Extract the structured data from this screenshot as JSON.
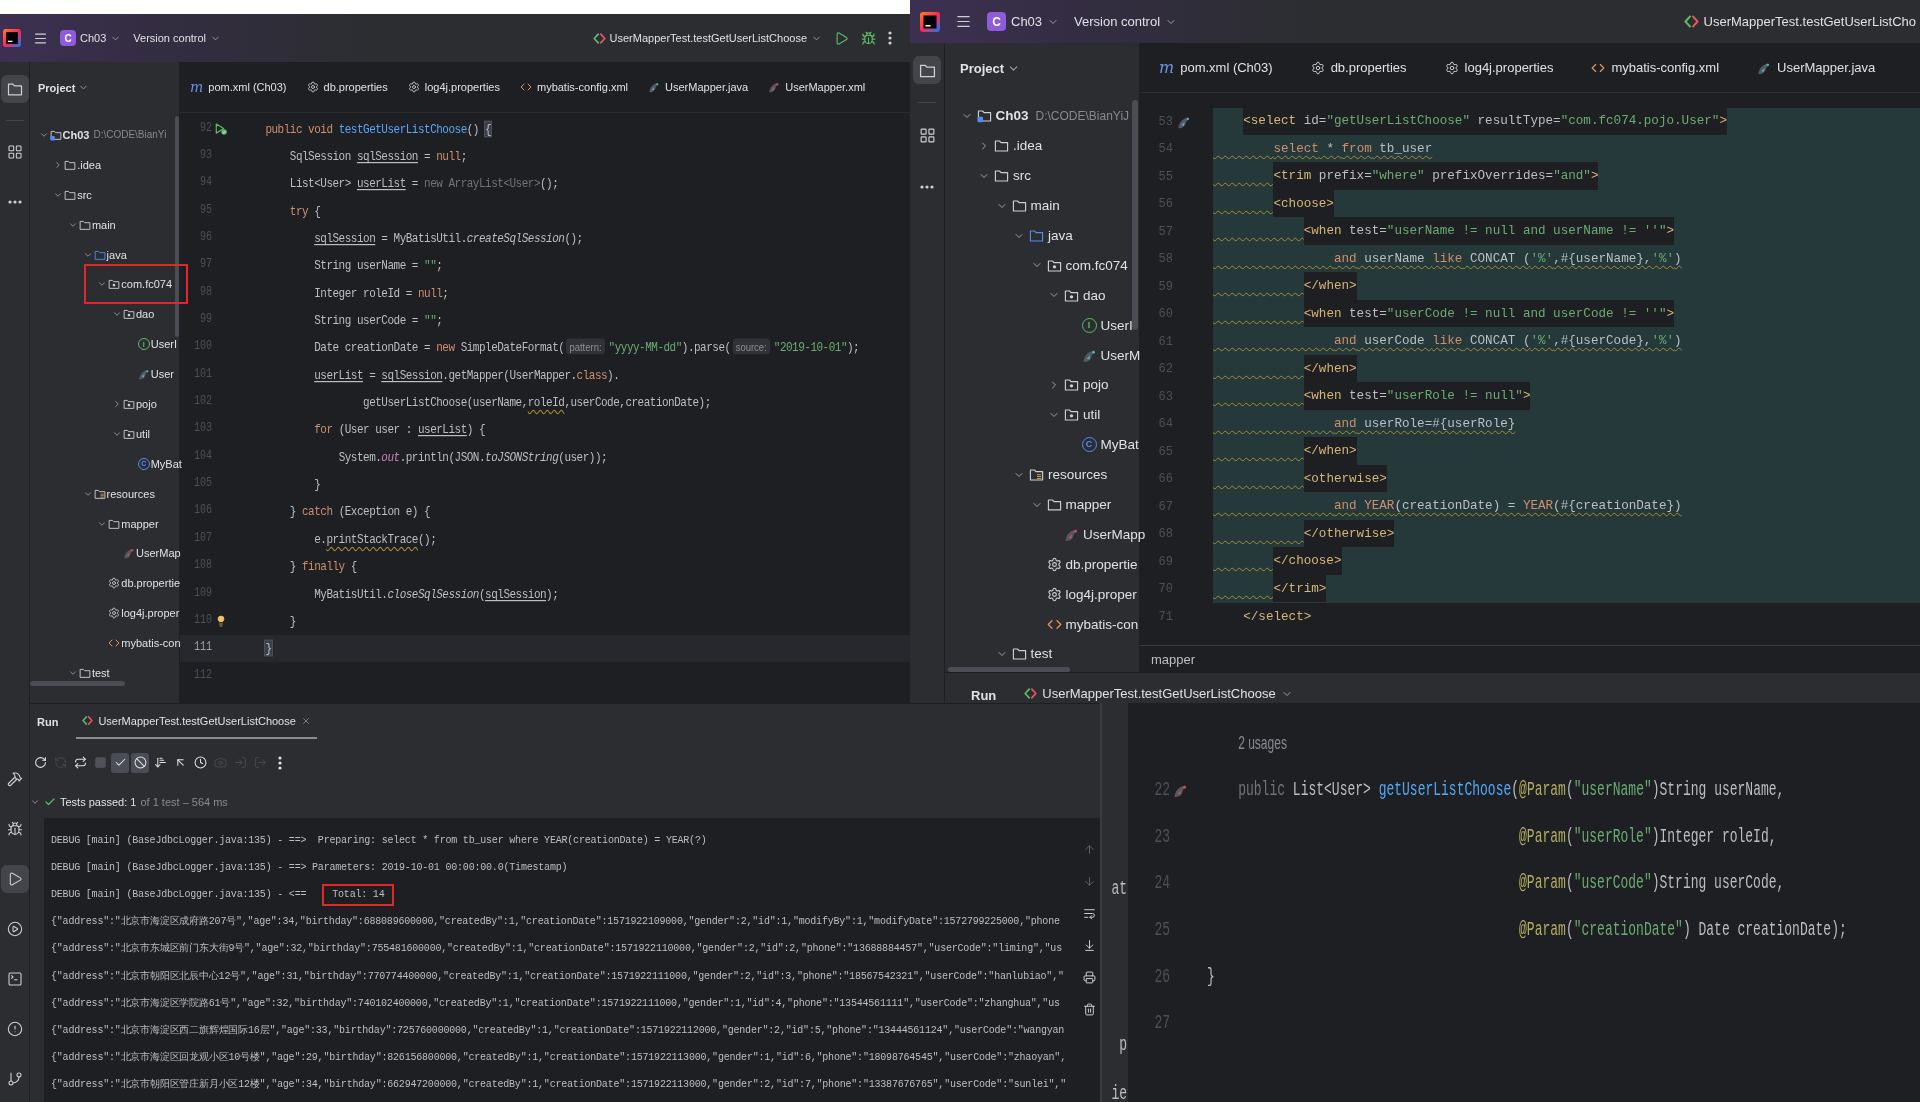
{
  "left_window": {
    "title_bar": {
      "project_initial": "C",
      "project": "Ch03",
      "vcs": "Version control",
      "run_config": "UserMapperTest.testGetUserListChoose"
    },
    "tool_strip": {
      "top": [
        {
          "kind": "project",
          "selected": true
        },
        {
          "kind": "structure",
          "selected": false
        },
        {
          "kind": "more",
          "selected": false
        }
      ],
      "bottom": [
        {
          "kind": "build",
          "selected": false
        },
        {
          "kind": "debug",
          "selected": false
        },
        {
          "kind": "run",
          "selected": true
        },
        {
          "kind": "services",
          "selected": false
        },
        {
          "kind": "terminal",
          "selected": false
        },
        {
          "kind": "problems",
          "selected": false
        },
        {
          "kind": "vcs",
          "selected": false
        }
      ]
    },
    "project_panel": {
      "title": "Project",
      "tree": [
        {
          "label": "Ch03",
          "path": "D:\\CODE\\BianYi",
          "kind": "module",
          "expanded": true,
          "marked": false,
          "children": [
            {
              "label": ".idea",
              "kind": "folder",
              "expanded": false,
              "marked": false
            },
            {
              "label": "src",
              "kind": "folder",
              "expanded": true,
              "marked": false,
              "children": [
                {
                  "label": "main",
                  "kind": "folder",
                  "expanded": true,
                  "marked": false,
                  "children": [
                    {
                      "label": "java",
                      "kind": "source",
                      "expanded": true,
                      "marked": false,
                      "children": [
                        {
                          "label": "com.fc074",
                          "kind": "package",
                          "expanded": true,
                          "marked": true,
                          "children": [
                            {
                              "label": "dao",
                              "kind": "package",
                              "expanded": true,
                              "marked": false,
                              "children": [
                                {
                                  "label": "UserI",
                                  "kind": "interface",
                                  "glyph": "I",
                                  "marked": false
                                },
                                {
                                  "label": "User",
                                  "kind": "mapper-java",
                                  "marked": false
                                }
                              ]
                            },
                            {
                              "label": "pojo",
                              "kind": "package",
                              "expanded": false,
                              "marked": false
                            },
                            {
                              "label": "util",
                              "kind": "package",
                              "expanded": true,
                              "marked": false,
                              "children": [
                                {
                                  "label": "MyBat",
                                  "kind": "class",
                                  "glyph": "C",
                                  "marked": false
                                }
                              ]
                            }
                          ]
                        }
                      ]
                    },
                    {
                      "label": "resources",
                      "kind": "resources",
                      "expanded": true,
                      "marked": false,
                      "children": [
                        {
                          "label": "mapper",
                          "kind": "folder",
                          "expanded": true,
                          "marked": false,
                          "children": [
                            {
                              "label": "UserMap",
                              "kind": "mapper-xml",
                              "marked": false
                            }
                          ]
                        },
                        {
                          "label": "db.propertie",
                          "kind": "properties",
                          "marked": false
                        },
                        {
                          "label": "log4j.proper",
                          "kind": "properties",
                          "marked": false
                        },
                        {
                          "label": "mybatis-con",
                          "kind": "xml",
                          "marked": false
                        }
                      ]
                    }
                  ]
                },
                {
                  "label": "test",
                  "kind": "folder",
                  "expanded": true,
                  "marked": false
                }
              ]
            }
          ]
        }
      ]
    },
    "tabs": [
      {
        "kind": "maven",
        "glyph": "m",
        "label": "pom.xml (Ch03)"
      },
      {
        "kind": "properties",
        "label": "db.properties"
      },
      {
        "kind": "properties",
        "label": "log4j.properties"
      },
      {
        "kind": "xml",
        "label": "mybatis-config.xml"
      },
      {
        "kind": "mapper-java",
        "label": "UserMapper.java"
      },
      {
        "kind": "mapper-xml",
        "label": "UserMapper.xml"
      }
    ],
    "editor": {
      "lines": [
        {
          "number": "92",
          "marker": {
            "kind": "run"
          },
          "current": false,
          "segments": [
            {
              "kind": "keyword",
              "text": "    public void "
            },
            {
              "kind": "method",
              "text": "testGetUserListChoose"
            },
            {
              "kind": "plain",
              "text": "() "
            },
            {
              "kind": "brace",
              "text": "{"
            }
          ]
        },
        {
          "number": "93",
          "current": false,
          "segments": [
            {
              "kind": "plain",
              "text": "        SqlSession "
            },
            {
              "kind": "reassigned",
              "text": "sqlSession"
            },
            {
              "kind": "plain",
              "text": " = "
            },
            {
              "kind": "keyword",
              "text": "null"
            },
            {
              "kind": "plain",
              "text": ";"
            }
          ]
        },
        {
          "number": "94",
          "current": false,
          "segments": [
            {
              "kind": "plain",
              "text": "        List<User> "
            },
            {
              "kind": "reassigned",
              "text": "userList"
            },
            {
              "kind": "plain",
              "text": " = "
            },
            {
              "kind": "dim",
              "text": "new ArrayList<User>"
            },
            {
              "kind": "plain",
              "text": "();"
            }
          ]
        },
        {
          "number": "95",
          "current": false,
          "segments": [
            {
              "kind": "keyword",
              "text": "        try "
            },
            {
              "kind": "plain",
              "text": "{"
            }
          ]
        },
        {
          "number": "96",
          "current": false,
          "segments": [
            {
              "kind": "reassigned",
              "text": "            sqlSession"
            },
            {
              "kind": "plain",
              "text": " = MyBatisUtil."
            },
            {
              "kind": "static",
              "text": "createSqlSession"
            },
            {
              "kind": "plain",
              "text": "();"
            }
          ]
        },
        {
          "number": "97",
          "current": false,
          "segments": [
            {
              "kind": "plain",
              "text": "            String userName = "
            },
            {
              "kind": "string",
              "text": "\"\""
            },
            {
              "kind": "plain",
              "text": ";"
            }
          ]
        },
        {
          "number": "98",
          "current": false,
          "segments": [
            {
              "kind": "plain",
              "text": "            Integer roleId = "
            },
            {
              "kind": "keyword",
              "text": "null"
            },
            {
              "kind": "plain",
              "text": ";"
            }
          ]
        },
        {
          "number": "99",
          "current": false,
          "segments": [
            {
              "kind": "plain",
              "text": "            String userCode = "
            },
            {
              "kind": "string",
              "text": "\"\""
            },
            {
              "kind": "plain",
              "text": ";"
            }
          ]
        },
        {
          "number": "100",
          "current": false,
          "segments": [
            {
              "kind": "plain",
              "text": "            Date creationDate = "
            },
            {
              "kind": "keyword",
              "text": "new "
            },
            {
              "kind": "plain",
              "text": "SimpleDateFormat("
            },
            {
              "kind": "hint",
              "text": "pattern:"
            },
            {
              "kind": "string",
              "text": "\"yyyy-MM-dd\""
            },
            {
              "kind": "plain",
              "text": ").parse("
            },
            {
              "kind": "hint",
              "text": "source:"
            },
            {
              "kind": "string",
              "text": "\"2019-10-01\""
            },
            {
              "kind": "plain",
              "text": ");"
            }
          ]
        },
        {
          "number": "101",
          "current": false,
          "segments": [
            {
              "kind": "reassigned",
              "text": "            userList"
            },
            {
              "kind": "plain",
              "text": " = "
            },
            {
              "kind": "reassigned",
              "text": "sqlSession"
            },
            {
              "kind": "plain",
              "text": ".getMapper(UserMapper."
            },
            {
              "kind": "keyword",
              "text": "class"
            },
            {
              "kind": "plain",
              "text": ")."
            }
          ]
        },
        {
          "number": "102",
          "current": false,
          "segments": [
            {
              "kind": "plain",
              "text": "                    getUserListChoose(userName,"
            },
            {
              "kind": "warning",
              "text": "roleId"
            },
            {
              "kind": "plain",
              "text": ",userCode,creationDate);"
            }
          ]
        },
        {
          "number": "103",
          "current": false,
          "segments": [
            {
              "kind": "keyword",
              "text": "            for "
            },
            {
              "kind": "plain",
              "text": "(User user : "
            },
            {
              "kind": "reassigned",
              "text": "userList"
            },
            {
              "kind": "plain",
              "text": ") {"
            }
          ]
        },
        {
          "number": "104",
          "current": false,
          "segments": [
            {
              "kind": "plain",
              "text": "                System."
            },
            {
              "kind": "field",
              "text": "out"
            },
            {
              "kind": "plain",
              "text": ".println(JSON."
            },
            {
              "kind": "static",
              "text": "toJSONString"
            },
            {
              "kind": "plain",
              "text": "(user));"
            }
          ]
        },
        {
          "number": "105",
          "current": false,
          "segments": [
            {
              "kind": "plain",
              "text": "            }"
            }
          ]
        },
        {
          "number": "106",
          "current": false,
          "segments": [
            {
              "kind": "plain",
              "text": "        } "
            },
            {
              "kind": "keyword",
              "text": "catch "
            },
            {
              "kind": "plain",
              "text": "(Exception e) {"
            }
          ]
        },
        {
          "number": "107",
          "current": false,
          "segments": [
            {
              "kind": "plain",
              "text": "            e."
            },
            {
              "kind": "warning",
              "text": "printStackTrace"
            },
            {
              "kind": "plain",
              "text": "();"
            }
          ]
        },
        {
          "number": "108",
          "current": false,
          "segments": [
            {
              "kind": "plain",
              "text": "        } "
            },
            {
              "kind": "keyword",
              "text": "finally "
            },
            {
              "kind": "plain",
              "text": "{"
            }
          ]
        },
        {
          "number": "109",
          "current": false,
          "segments": [
            {
              "kind": "plain",
              "text": "            MyBatisUtil."
            },
            {
              "kind": "static",
              "text": "closeSqlSession"
            },
            {
              "kind": "plain",
              "text": "("
            },
            {
              "kind": "reassigned",
              "text": "sqlSession"
            },
            {
              "kind": "plain",
              "text": ");"
            }
          ]
        },
        {
          "number": "110",
          "marker": {
            "kind": "intention"
          },
          "current": false,
          "segments": [
            {
              "kind": "plain",
              "text": "        }"
            }
          ]
        },
        {
          "number": "111",
          "current": true,
          "segments": [
            {
              "kind": "brace",
              "text": "    }"
            }
          ]
        },
        {
          "number": "112",
          "current": false
        }
      ]
    },
    "run_panel": {
      "title": "Run",
      "tab": "UserMapperTest.testGetUserListChoose",
      "toolbar": [
        {
          "kind": "rerun",
          "on": false,
          "disabled": false
        },
        {
          "kind": "rerun-failed",
          "on": false,
          "disabled": true
        },
        {
          "kind": "rerun-auto",
          "on": false,
          "disabled": false
        },
        {
          "kind": "stop",
          "on": false,
          "disabled": true
        },
        {
          "kind": "show-passed",
          "on": true,
          "disabled": false
        },
        {
          "kind": "show-ignored",
          "on": true,
          "disabled": false
        },
        {
          "kind": "sort",
          "on": false,
          "disabled": false
        },
        {
          "kind": "collapse",
          "on": false,
          "disabled": false
        },
        {
          "kind": "history",
          "on": false,
          "disabled": false
        },
        {
          "kind": "screenshot",
          "on": false,
          "disabled": true
        },
        {
          "kind": "import",
          "on": false,
          "disabled": true
        },
        {
          "kind": "export",
          "on": false,
          "disabled": true
        },
        {
          "kind": "more",
          "on": false,
          "disabled": false
        }
      ],
      "summary": {
        "expanded": true,
        "status": "Tests passed: 1",
        "detail": "of 1 test – 564 ms"
      },
      "console": [
        {
          "parts": [
            {
              "text": "DEBUG [main] (BaseJdbcLogger.java:135) - ==>  Preparing: select * from tb_user where YEAR(creationDate) = YEAR(?)",
              "marked": false
            }
          ]
        },
        {
          "parts": [
            {
              "text": "DEBUG [main] (BaseJdbcLogger.java:135) - ==> Parameters: 2019-10-01 00:00:00.0(Timestamp)",
              "marked": false
            }
          ]
        },
        {
          "parts": [
            {
              "text": "DEBUG [main] (BaseJdbcLogger.java:135) - <==",
              "marked": false
            },
            {
              "text": "Total: 14",
              "marked": true
            }
          ]
        },
        {
          "parts": [
            {
              "text": "{\"address\":\"北京市海淀区成府路207号\",\"age\":34,\"birthday\":688089600000,\"createdBy\":1,\"creationDate\":1571922109000,\"gender\":2,\"id\":1,\"modifyBy\":1,\"modifyDate\":1572799225000,\"phone",
              "marked": false
            }
          ]
        },
        {
          "parts": [
            {
              "text": "{\"address\":\"北京市东城区前门东大街9号\",\"age\":32,\"birthday\":755481600000,\"createdBy\":1,\"creationDate\":1571922110000,\"gender\":2,\"id\":2,\"phone\":\"13688884457\",\"userCode\":\"liming\",\"us",
              "marked": false
            }
          ]
        },
        {
          "parts": [
            {
              "text": "{\"address\":\"北京市朝阳区北辰中心12号\",\"age\":31,\"birthday\":770774400000,\"createdBy\":1,\"creationDate\":1571922111000,\"gender\":2,\"id\":3,\"phone\":\"18567542321\",\"userCode\":\"hanlubiao\",\"",
              "marked": false
            }
          ]
        },
        {
          "parts": [
            {
              "text": "{\"address\":\"北京市海淀区学院路61号\",\"age\":32,\"birthday\":740102400000,\"createdBy\":1,\"creationDate\":1571922111000,\"gender\":1,\"id\":4,\"phone\":\"13544561111\",\"userCode\":\"zhanghua\",\"us",
              "marked": false
            }
          ]
        },
        {
          "parts": [
            {
              "text": "{\"address\":\"北京市海淀区西二旗辉煌国际16层\",\"age\":33,\"birthday\":725760000000,\"createdBy\":1,\"creationDate\":1571922112000,\"gender\":2,\"id\":5,\"phone\":\"13444561124\",\"userCode\":\"wangyan",
              "marked": false
            }
          ]
        },
        {
          "parts": [
            {
              "text": "{\"address\":\"北京市海淀区回龙观小区10号楼\",\"age\":29,\"birthday\":826156800000,\"createdBy\":1,\"creationDate\":1571922113000,\"gender\":1,\"id\":6,\"phone\":\"18098764545\",\"userCode\":\"zhaoyan\",",
              "marked": false
            }
          ]
        },
        {
          "parts": [
            {
              "text": "{\"address\":\"北京市朝阳区管庄新月小区12楼\",\"age\":34,\"birthday\":662947200000,\"createdBy\":1,\"creationDate\":1571922113000,\"gender\":2,\"id\":7,\"phone\":\"13387676765\",\"userCode\":\"sunlei\",\"",
              "marked": false
            }
          ]
        }
      ]
    }
  },
  "right_window": {
    "title_bar": {
      "project_initial": "C",
      "project": "Ch03",
      "vcs": "Version control",
      "run_config": "UserMapperTest.testGetUserListCho"
    },
    "tool_strip": {
      "top": [
        {
          "kind": "project",
          "selected": true
        },
        {
          "kind": "structure",
          "selected": false
        },
        {
          "kind": "more",
          "selected": false
        }
      ]
    },
    "project_panel": {
      "title": "Project",
      "tree": [
        {
          "label": "Ch03",
          "path": "D:\\CODE\\BianYiJ",
          "kind": "module",
          "expanded": true,
          "children": [
            {
              "label": ".idea",
              "kind": "folder",
              "expanded": false
            },
            {
              "label": "src",
              "kind": "folder",
              "expanded": true,
              "children": [
                {
                  "label": "main",
                  "kind": "folder",
                  "expanded": true,
                  "children": [
                    {
                      "label": "java",
                      "kind": "source",
                      "expanded": true,
                      "children": [
                        {
                          "label": "com.fc074",
                          "kind": "package",
                          "expanded": true,
                          "children": [
                            {
                              "label": "dao",
                              "kind": "package",
                              "expanded": true,
                              "children": [
                                {
                                  "label": "UserI",
                                  "kind": "interface",
                                  "glyph": "I"
                                },
                                {
                                  "label": "UserM",
                                  "kind": "mapper-java"
                                }
                              ]
                            },
                            {
                              "label": "pojo",
                              "kind": "package",
                              "expanded": false
                            },
                            {
                              "label": "util",
                              "kind": "package",
                              "expanded": true,
                              "children": [
                                {
                                  "label": "MyBat",
                                  "kind": "class",
                                  "glyph": "C"
                                }
                              ]
                            }
                          ]
                        }
                      ]
                    },
                    {
                      "label": "resources",
                      "kind": "resources",
                      "expanded": true,
                      "children": [
                        {
                          "label": "mapper",
                          "kind": "folder",
                          "expanded": true,
                          "children": [
                            {
                              "label": "UserMapp",
                              "kind": "mapper-xml"
                            }
                          ]
                        },
                        {
                          "label": "db.propertie",
                          "kind": "properties"
                        },
                        {
                          "label": "log4j.proper",
                          "kind": "properties"
                        },
                        {
                          "label": "mybatis-con",
                          "kind": "xml"
                        }
                      ]
                    }
                  ]
                },
                {
                  "label": "test",
                  "kind": "folder",
                  "expanded": true
                }
              ]
            }
          ]
        }
      ]
    },
    "tabs": [
      {
        "kind": "maven",
        "glyph": "m",
        "label": "pom.xml (Ch03)"
      },
      {
        "kind": "properties",
        "label": "db.properties"
      },
      {
        "kind": "properties",
        "label": "log4j.properties"
      },
      {
        "kind": "xml",
        "label": "mybatis-config.xml"
      },
      {
        "kind": "mapper-java",
        "label": "UserMapper.java"
      }
    ],
    "editor": {
      "lines": [
        {
          "number": "53",
          "marker": {
            "kind": "mapper-java"
          },
          "highlighted": true,
          "warning": false,
          "segments": [
            {
              "kind": "tag",
              "text": "    <select"
            },
            {
              "kind": "attr",
              "text": " id="
            },
            {
              "kind": "value",
              "text": "\"getUserListChoose\""
            },
            {
              "kind": "attr",
              "text": " resultType="
            },
            {
              "kind": "value",
              "text": "\"com.fc074.pojo.User\""
            },
            {
              "kind": "tag",
              "text": ">"
            }
          ]
        },
        {
          "number": "54",
          "highlighted": true,
          "warning": true,
          "segments": [
            {
              "kind": "sql-keyword",
              "text": "        select"
            },
            {
              "kind": "sql",
              "text": " * "
            },
            {
              "kind": "sql-keyword",
              "text": "from"
            },
            {
              "kind": "sql",
              "text": " tb_user"
            }
          ]
        },
        {
          "number": "55",
          "highlighted": true,
          "warning": true,
          "segments": [
            {
              "kind": "tag",
              "text": "        <trim"
            },
            {
              "kind": "attr",
              "text": " prefix="
            },
            {
              "kind": "value",
              "text": "\"where\""
            },
            {
              "kind": "attr",
              "text": " prefixOverrides="
            },
            {
              "kind": "value",
              "text": "\"and\""
            },
            {
              "kind": "tag",
              "text": ">"
            }
          ]
        },
        {
          "number": "56",
          "highlighted": true,
          "warning": true,
          "segments": [
            {
              "kind": "tag",
              "text": "        <choose>"
            }
          ]
        },
        {
          "number": "57",
          "highlighted": true,
          "warning": true,
          "segments": [
            {
              "kind": "tag",
              "text": "            <when"
            },
            {
              "kind": "attr",
              "text": " test="
            },
            {
              "kind": "value",
              "text": "\"userName != null and userName != ''\""
            },
            {
              "kind": "tag",
              "text": ">"
            }
          ]
        },
        {
          "number": "58",
          "highlighted": true,
          "warning": true,
          "segments": [
            {
              "kind": "sql-keyword",
              "text": "                and"
            },
            {
              "kind": "sql",
              "text": " userName "
            },
            {
              "kind": "sql-keyword",
              "text": "like"
            },
            {
              "kind": "sql",
              "text": " CONCAT ("
            },
            {
              "kind": "sql-string",
              "text": "'%'"
            },
            {
              "kind": "sql",
              "text": ",#{userName},"
            },
            {
              "kind": "sql-string",
              "text": "'%'"
            },
            {
              "kind": "sql",
              "text": ")"
            }
          ]
        },
        {
          "number": "59",
          "highlighted": true,
          "warning": true,
          "segments": [
            {
              "kind": "tag",
              "text": "            </when>"
            }
          ]
        },
        {
          "number": "60",
          "highlighted": true,
          "warning": true,
          "segments": [
            {
              "kind": "tag",
              "text": "            <when"
            },
            {
              "kind": "attr",
              "text": " test="
            },
            {
              "kind": "value",
              "text": "\"userCode != null and userCode != ''\""
            },
            {
              "kind": "tag",
              "text": ">"
            }
          ]
        },
        {
          "number": "61",
          "highlighted": true,
          "warning": true,
          "segments": [
            {
              "kind": "sql-keyword",
              "text": "                and"
            },
            {
              "kind": "sql",
              "text": " userCode "
            },
            {
              "kind": "sql-keyword",
              "text": "like"
            },
            {
              "kind": "sql",
              "text": " CONCAT ("
            },
            {
              "kind": "sql-string",
              "text": "'%'"
            },
            {
              "kind": "sql",
              "text": ",#{userCode},"
            },
            {
              "kind": "sql-string",
              "text": "'%'"
            },
            {
              "kind": "sql",
              "text": ")"
            }
          ]
        },
        {
          "number": "62",
          "highlighted": true,
          "warning": true,
          "segments": [
            {
              "kind": "tag",
              "text": "            </when>"
            }
          ]
        },
        {
          "number": "63",
          "highlighted": true,
          "warning": true,
          "segments": [
            {
              "kind": "tag",
              "text": "            <when"
            },
            {
              "kind": "attr",
              "text": " test="
            },
            {
              "kind": "value",
              "text": "\"userRole != null\""
            },
            {
              "kind": "tag",
              "text": ">"
            }
          ]
        },
        {
          "number": "64",
          "highlighted": true,
          "warning": true,
          "segments": [
            {
              "kind": "sql-keyword",
              "text": "                and"
            },
            {
              "kind": "sql",
              "text": " userRole=#{userRole}"
            }
          ]
        },
        {
          "number": "65",
          "highlighted": true,
          "warning": true,
          "segments": [
            {
              "kind": "tag",
              "text": "            </when>"
            }
          ]
        },
        {
          "number": "66",
          "highlighted": true,
          "warning": true,
          "segments": [
            {
              "kind": "tag",
              "text": "            <otherwise>"
            }
          ]
        },
        {
          "number": "67",
          "highlighted": true,
          "warning": true,
          "segments": [
            {
              "kind": "sql-keyword",
              "text": "                and YEAR"
            },
            {
              "kind": "sql",
              "text": "(creationDate) = "
            },
            {
              "kind": "sql-keyword",
              "text": "YEAR"
            },
            {
              "kind": "sql",
              "text": "(#{creationDate})"
            }
          ]
        },
        {
          "number": "68",
          "highlighted": true,
          "warning": true,
          "segments": [
            {
              "kind": "tag",
              "text": "            </otherwise>"
            }
          ]
        },
        {
          "number": "69",
          "highlighted": true,
          "warning": true,
          "segments": [
            {
              "kind": "tag",
              "text": "        </choose>"
            }
          ]
        },
        {
          "number": "70",
          "highlighted": true,
          "warning": true,
          "segments": [
            {
              "kind": "tag",
              "text": "        </trim>"
            }
          ]
        },
        {
          "number": "71",
          "highlighted": false,
          "warning": false,
          "segments": [
            {
              "kind": "tag",
              "text": "    </select>"
            }
          ]
        }
      ]
    },
    "breadcrumb": "mapper",
    "run_panel": {
      "title": "Run",
      "tab": "UserMapperTest.testGetUserListChoose"
    }
  },
  "console_fragments": [
    {
      "text": "at"
    },
    {
      "text": "p"
    },
    {
      "text": "ie"
    }
  ],
  "code_snippet": {
    "usages": "2 usages",
    "lines": [
      {
        "number": "22",
        "marker": {
          "kind": "mapper-xml"
        },
        "segments": [
          {
            "kind": "dim",
            "text": "    public "
          },
          {
            "kind": "plain",
            "text": "List<User> "
          },
          {
            "kind": "method",
            "text": "getUserListChoose"
          },
          {
            "kind": "plain",
            "text": "("
          },
          {
            "kind": "annotation",
            "text": "@Param"
          },
          {
            "kind": "plain",
            "text": "("
          },
          {
            "kind": "string",
            "text": "\"userName\""
          },
          {
            "kind": "plain",
            "text": ")String userName,"
          }
        ]
      },
      {
        "number": "23",
        "segments": [
          {
            "kind": "annotation",
            "text": "                                        @Param"
          },
          {
            "kind": "plain",
            "text": "("
          },
          {
            "kind": "string",
            "text": "\"userRole\""
          },
          {
            "kind": "plain",
            "text": ")Integer roleId,"
          }
        ]
      },
      {
        "number": "24",
        "segments": [
          {
            "kind": "annotation",
            "text": "                                        @Param"
          },
          {
            "kind": "plain",
            "text": "("
          },
          {
            "kind": "string",
            "text": "\"userCode\""
          },
          {
            "kind": "plain",
            "text": ")String userCode,"
          }
        ]
      },
      {
        "number": "25",
        "segments": [
          {
            "kind": "annotation",
            "text": "                                        @Param"
          },
          {
            "kind": "plain",
            "text": "("
          },
          {
            "kind": "string",
            "text": "\"creationDate\""
          },
          {
            "kind": "plain",
            "text": ") Date creationDate);"
          }
        ]
      },
      {
        "number": "26",
        "segments": [
          {
            "kind": "plain",
            "text": "}"
          }
        ]
      },
      {
        "number": "27"
      }
    ]
  }
}
